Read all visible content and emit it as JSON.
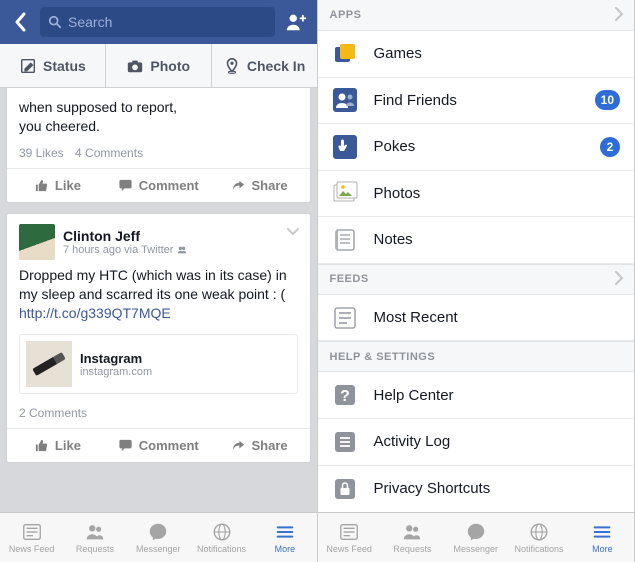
{
  "left": {
    "search_placeholder": "Search",
    "composer": {
      "status": "Status",
      "photo": "Photo",
      "checkin": "Check In"
    },
    "post1": {
      "body_line1": "when supposed to report,",
      "body_line2": "you cheered.",
      "likes": "39 Likes",
      "comments": "4 Comments"
    },
    "post2": {
      "author": "Clinton Jeff",
      "meta": "7 hours ago via Twitter",
      "body_pre": "Dropped my HTC (which was in its case) in my sleep and scarred its one weak point : ( ",
      "body_link": "http://t.co/g339QT7MQE",
      "attach_title": "Instagram",
      "attach_sub": "instagram.com",
      "comments": "2 Comments"
    },
    "actions": {
      "like": "Like",
      "comment": "Comment",
      "share": "Share"
    }
  },
  "right": {
    "sections": {
      "apps": "APPS",
      "feeds": "FEEDS",
      "help": "HELP & SETTINGS"
    },
    "apps": {
      "games": "Games",
      "find_friends": "Find Friends",
      "find_friends_badge": "10",
      "pokes": "Pokes",
      "pokes_badge": "2",
      "photos": "Photos",
      "notes": "Notes"
    },
    "feeds": {
      "most_recent": "Most Recent"
    },
    "help": {
      "help_center": "Help Center",
      "activity_log": "Activity Log",
      "privacy": "Privacy Shortcuts"
    }
  },
  "tabs": {
    "newsfeed": "News Feed",
    "requests": "Requests",
    "messenger": "Messenger",
    "notifications": "Notifications",
    "more": "More"
  }
}
